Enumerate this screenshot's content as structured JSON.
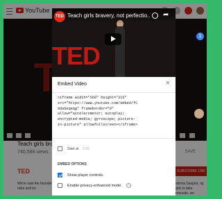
{
  "header": {
    "logo_text": "YouTube"
  },
  "video_bg": {
    "stage_text": "TED"
  },
  "below": {
    "title": "Teach girls brave",
    "views": "740,588 views",
    "save": "SAVE",
    "channel": "TED",
    "subscribe": "SUBSCRIBE 13M",
    "desc_left": "We're raisi the founder risks and bo",
    "desc_right": "eshma Saujani, ng girls to take innovate, we"
  },
  "embed_video": {
    "channel_badge": "TED",
    "title": "Teach girls bravery, not perfectio...",
    "stage_text": "TED"
  },
  "modal": {
    "title": "Embed Video",
    "code": "<iframe width=\"560\" height=\"315\"\nsrc=\"https://www.youtube.com/embed/fC\n9da6eqaqg\" frameborder=\"0\"\nallow=\"accelerometer; autoplay;\nencrypted-media; gyroscope; picture-\nin-picture\" allowfullscreen></iframe>",
    "start_at_label": "Start at",
    "start_at_time": "3:15",
    "options_heading": "EMBED OPTIONS",
    "show_controls_label": "Show player controls.",
    "show_controls_checked": true,
    "privacy_label": "Enable privacy-enhanced mode.",
    "privacy_checked": false
  },
  "colors": {
    "accent": "#1a73e8",
    "brand_red": "#e62b1e",
    "border_green": "#35b86a"
  }
}
